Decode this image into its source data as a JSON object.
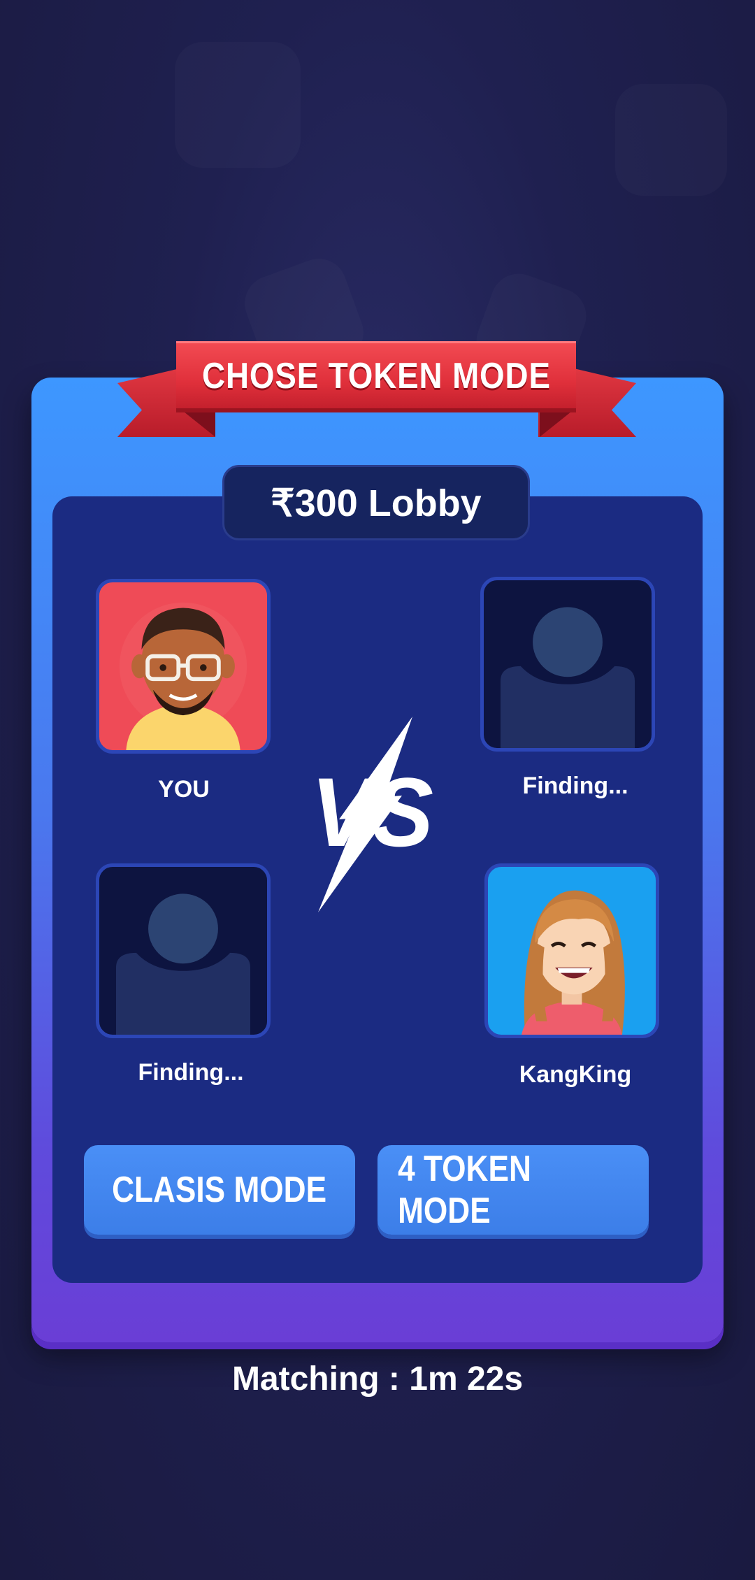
{
  "header": {
    "title": "CHOSE TOKEN MODE"
  },
  "lobby": {
    "label": "₹300 Lobby"
  },
  "players": [
    {
      "name": "YOU",
      "status": "joined"
    },
    {
      "name": "Finding...",
      "status": "searching"
    },
    {
      "name": "Finding...",
      "status": "searching"
    },
    {
      "name": "KangKing",
      "status": "joined"
    }
  ],
  "versus": {
    "icon": "vs-icon"
  },
  "modes": {
    "classic_label": "CLASIS MODE",
    "four_token_label": "4 TOKEN MODE"
  },
  "matching": {
    "text": "Matching : 1m 22s"
  },
  "colors": {
    "background": "#1f2050",
    "card_top": "#3d97ff",
    "card_bottom": "#6a3ed6",
    "inner_panel": "#1b2b82",
    "ribbon": "#e0303b",
    "button": "#4a8ff6"
  }
}
